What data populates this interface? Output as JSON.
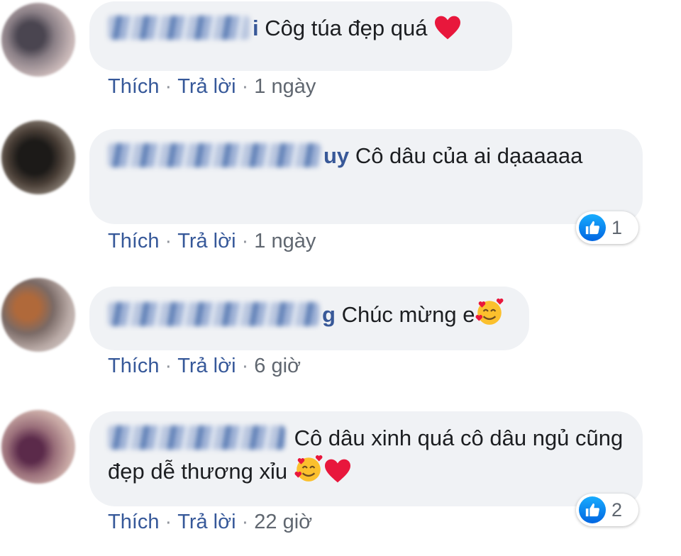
{
  "colors": {
    "bubble_bg": "#f0f2f5",
    "link": "#385898",
    "like_blue": "#1877f2",
    "heart_red": "#e8173c"
  },
  "comments": [
    {
      "author_suffix": "i",
      "text": "Côg túa đẹp quá",
      "emojis": [
        "red-heart"
      ],
      "actions": {
        "like": "Thích",
        "reply": "Trả lời",
        "time": "1 ngày"
      },
      "reactions": null
    },
    {
      "author_suffix": "uy",
      "text": "Cô dâu của ai dạaaaaa",
      "emojis": [],
      "actions": {
        "like": "Thích",
        "reply": "Trả lời",
        "time": "1 ngày"
      },
      "reactions": {
        "icon": "like-icon",
        "count": "1"
      }
    },
    {
      "author_suffix": "g",
      "text": "Chúc mừng e",
      "emojis": [
        "smiling-face-with-hearts"
      ],
      "actions": {
        "like": "Thích",
        "reply": "Trả lời",
        "time": "6 giờ"
      },
      "reactions": null
    },
    {
      "author_suffix": "",
      "text": "Cô dâu xinh quá cô dâu ngủ cũng đẹp dễ thương xỉu",
      "emojis": [
        "smiling-face-with-hearts",
        "red-heart"
      ],
      "actions": {
        "like": "Thích",
        "reply": "Trả lời",
        "time": "22 giờ"
      },
      "reactions": {
        "icon": "like-icon",
        "count": "2"
      }
    }
  ]
}
